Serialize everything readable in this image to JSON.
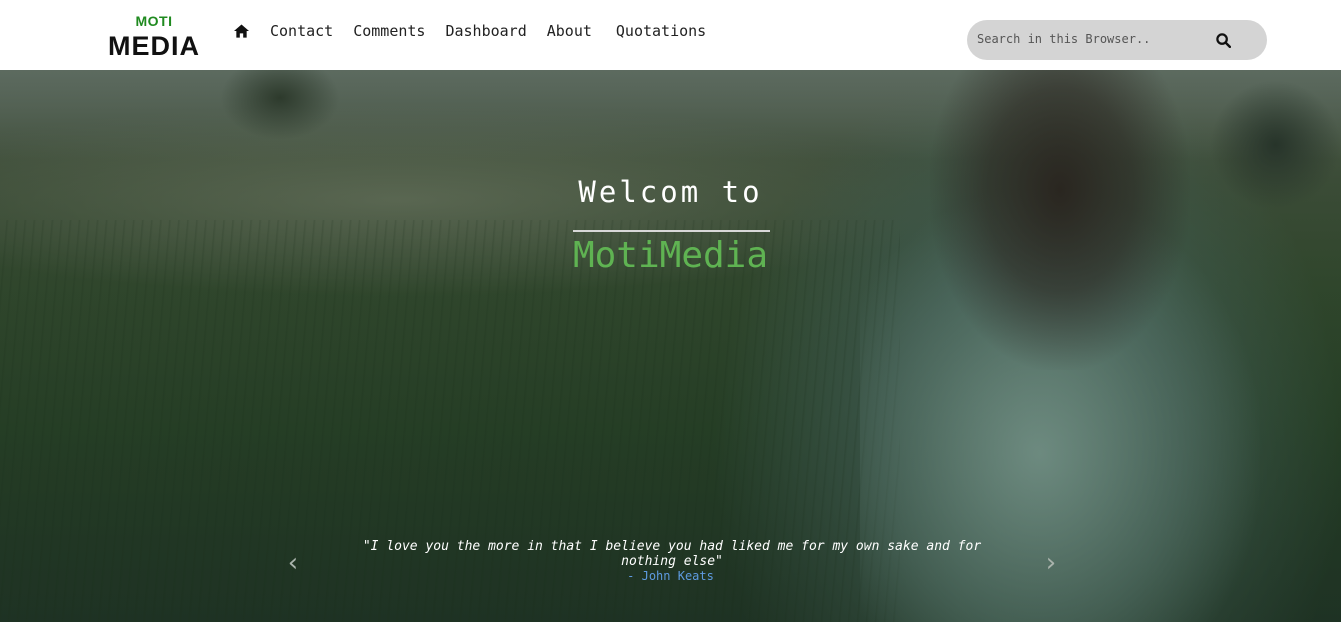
{
  "header": {
    "logo_top": "MOTI",
    "logo_bottom": "MEDIA",
    "nav": {
      "home_icon": "home-icon",
      "items": [
        "Contact",
        "Comments",
        "Dashboard",
        "About",
        "Quotations"
      ]
    },
    "search": {
      "placeholder": "Search in this Browser..",
      "icon": "search-icon"
    }
  },
  "hero": {
    "welcome": "Welcom to",
    "brand": "MotiMedia",
    "brand_color": "#5fb352",
    "quote": "\"I love you the more in that I believe you had liked me for my own sake and for nothing else\"",
    "author": "- John Keats",
    "author_color": "#5e9ae0",
    "prev_arrow": "‹",
    "next_arrow": "›"
  }
}
